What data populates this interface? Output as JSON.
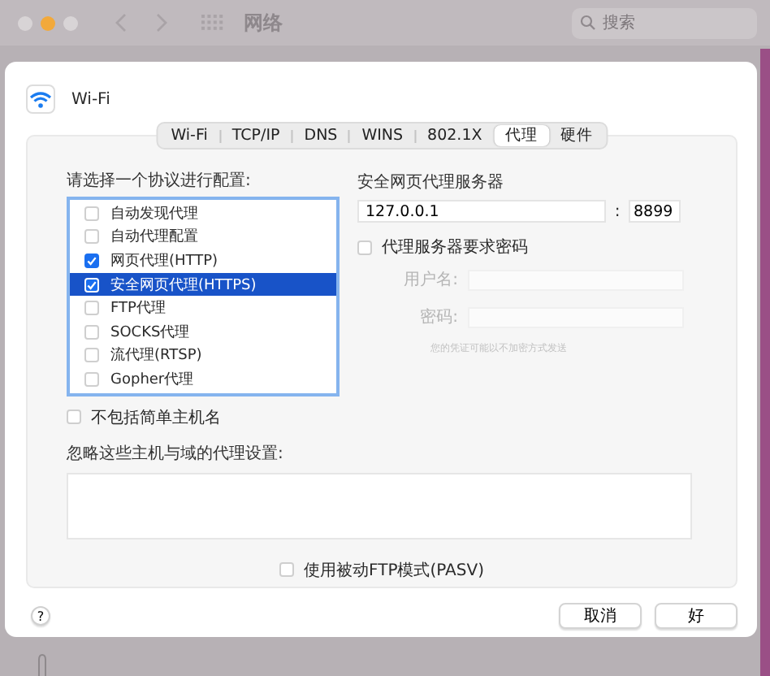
{
  "window": {
    "title": "网络",
    "search": {
      "placeholder": "搜索"
    }
  },
  "sheet": {
    "service": "Wi-Fi",
    "tabs": [
      {
        "label": "Wi-Fi",
        "selected": false
      },
      {
        "label": "TCP/IP",
        "selected": false
      },
      {
        "label": "DNS",
        "selected": false
      },
      {
        "label": "WINS",
        "selected": false
      },
      {
        "label": "802.1X",
        "selected": false
      },
      {
        "label": "代理",
        "selected": true
      },
      {
        "label": "硬件",
        "selected": false
      }
    ],
    "protocols": {
      "label": "请选择一个协议进行配置:",
      "items": [
        {
          "label": "自动发现代理",
          "checked": false,
          "selected": false
        },
        {
          "label": "自动代理配置",
          "checked": false,
          "selected": false
        },
        {
          "label": "网页代理(HTTP)",
          "checked": true,
          "selected": false
        },
        {
          "label": "安全网页代理(HTTPS)",
          "checked": true,
          "selected": true
        },
        {
          "label": "FTP代理",
          "checked": false,
          "selected": false
        },
        {
          "label": "SOCKS代理",
          "checked": false,
          "selected": false
        },
        {
          "label": "流代理(RTSP)",
          "checked": false,
          "selected": false
        },
        {
          "label": "Gopher代理",
          "checked": false,
          "selected": false
        }
      ]
    },
    "server": {
      "label": "安全网页代理服务器",
      "host": "127.0.0.1",
      "separator": ":",
      "port": "8899"
    },
    "auth": {
      "label": "代理服务器要求密码",
      "checked": false,
      "username_label": "用户名:",
      "password_label": "密码:",
      "disabled": true,
      "hint": "您的凭证可能以不加密方式发送"
    },
    "exclude_simple": {
      "label": "不包括简单主机名",
      "checked": false
    },
    "bypass": {
      "label": "忽略这些主机与域的代理设置:"
    },
    "pasv": {
      "label": "使用被动FTP模式(PASV)",
      "checked": false
    },
    "help": "?",
    "buttons": [
      "取消",
      "好"
    ]
  }
}
